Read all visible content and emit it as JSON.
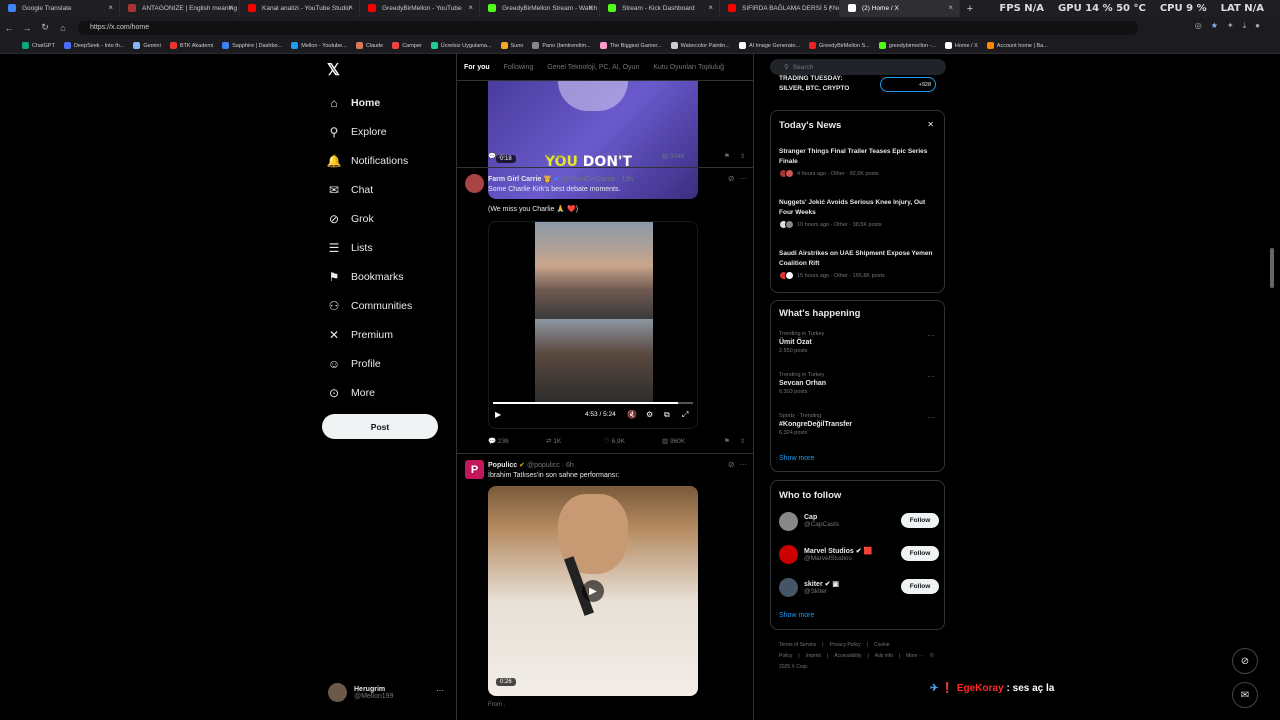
{
  "browser": {
    "tabs": [
      {
        "title": "Google Translate",
        "color": "#4285f4"
      },
      {
        "title": "ANTAGONIZE | English meaning -",
        "color": "#a33"
      },
      {
        "title": "Kanal analizi - YouTube Studio",
        "color": "#f00"
      },
      {
        "title": "GreedyBirMellon - YouTube",
        "color": "#f00"
      },
      {
        "title": "GreedyBirMellon Stream - Watch",
        "color": "#53fc18"
      },
      {
        "title": "Stream - Kick Dashboard",
        "color": "#53fc18"
      },
      {
        "title": "SIFIRDA BAĞLAMA DERSİ 5 ( Nota",
        "color": "#f00"
      },
      {
        "title": "(2) Home / X",
        "color": "#fff"
      }
    ],
    "new_tab": "+",
    "url": "https://x.com/home",
    "sysmon": [
      {
        "label": "FPS",
        "value": "N/A"
      },
      {
        "label": "GPU",
        "value": "14 %  50 °C"
      },
      {
        "label": "CPU",
        "value": "9 %"
      },
      {
        "label": "LAT",
        "value": "N/A"
      }
    ],
    "bookmarks": [
      {
        "label": "ChatGPT",
        "color": "#10a37f"
      },
      {
        "label": "DeepSeek - Into th...",
        "color": "#4d6bfe"
      },
      {
        "label": "Gemini",
        "color": "#8ab4f8"
      },
      {
        "label": "BTK Akademi",
        "color": "#e33"
      },
      {
        "label": "Sapphire | Dashbo...",
        "color": "#3b82f6"
      },
      {
        "label": "Mellon - Youtube...",
        "color": "#1d9bf0"
      },
      {
        "label": "Claude",
        "color": "#d97757"
      },
      {
        "label": "Camper",
        "color": "#e44"
      },
      {
        "label": "Ücretsiz Uygulama...",
        "color": "#2c9"
      },
      {
        "label": "Suno",
        "color": "#f5a623"
      },
      {
        "label": "Pano (bentrendim...",
        "color": "#888"
      },
      {
        "label": "The Biggest Gamer...",
        "color": "#f9c"
      },
      {
        "label": "Watercolor Paintin...",
        "color": "#ccc"
      },
      {
        "label": "AI Image Generato...",
        "color": "#fff"
      },
      {
        "label": "GreedyBirMellon S...",
        "color": "#e22"
      },
      {
        "label": "greedybirmellon -...",
        "color": "#53fc18"
      },
      {
        "label": "Home / X",
        "color": "#fff"
      },
      {
        "label": "Account home | Ba...",
        "color": "#f80"
      }
    ]
  },
  "x": {
    "logo": "𝕏",
    "nav": [
      {
        "label": "Home",
        "icon": "home-icon",
        "glyph": "⌂",
        "active": true
      },
      {
        "label": "Explore",
        "icon": "search-icon",
        "glyph": "⚲"
      },
      {
        "label": "Notifications",
        "icon": "bell-icon",
        "glyph": "🔔"
      },
      {
        "label": "Chat",
        "icon": "envelope-icon",
        "glyph": "✉"
      },
      {
        "label": "Grok",
        "icon": "grok-icon",
        "glyph": "⊘"
      },
      {
        "label": "Lists",
        "icon": "list-icon",
        "glyph": "☰"
      },
      {
        "label": "Bookmarks",
        "icon": "bookmark-icon",
        "glyph": "⚑"
      },
      {
        "label": "Communities",
        "icon": "people-icon",
        "glyph": "⚇"
      },
      {
        "label": "Premium",
        "icon": "x-icon",
        "glyph": "✕"
      },
      {
        "label": "Profile",
        "icon": "person-icon",
        "glyph": "☺"
      },
      {
        "label": "More",
        "icon": "more-circle-icon",
        "glyph": "⊙"
      }
    ],
    "post_button": "Post",
    "profile": {
      "name": "Herugrim",
      "handle": "@Mellon199",
      "more": "···"
    }
  },
  "feed": {
    "tabs": [
      "For you",
      "Following",
      "Genel Teknoloji, PC, AI, Oyun",
      "Kutu Oyunları Topluluğ"
    ],
    "tweet1": {
      "caption_yellow": "YOU",
      "caption_white": " DON'T",
      "duration": "0:18",
      "replies": "22",
      "reposts": "150",
      "likes": "1,7K",
      "views": "324K"
    },
    "tweet2": {
      "name": "Farm Girl Carrie 👸",
      "handle": "@FarmGirlCarrie · 15h",
      "text1": "Some Charlie Kirk's best debate moments.",
      "text2": "(We miss you Charlie 🙏 ❤️)",
      "time": "4:53 / 5:24",
      "replies": "236",
      "reposts": "1K",
      "likes": "6,9K",
      "views": "960K"
    },
    "tweet3": {
      "name": "Populicc",
      "handle": "@populicc · 6h",
      "text": "İbrahim Tatlıses'in son sahne performansı:",
      "duration": "0:26",
      "from": "From ."
    }
  },
  "sidebar": {
    "search_placeholder": "Search",
    "trading_line1": "TRADING TUESDAY:",
    "trading_line2": "SILVER, BTC, CRYPTO",
    "trading_count": "+928",
    "news_title": "Today's News",
    "news_close": "✕",
    "news": [
      {
        "title": "Stranger Things Final Trailer Teases Epic Series Finale",
        "meta": "4 hours ago · Other · 92,6K posts"
      },
      {
        "title": "Nuggets' Jokić Avoids Serious Knee Injury, Out Four Weeks",
        "meta": "10 hours ago · Other · 38,5K posts"
      },
      {
        "title": "Saudi Airstrikes on UAE Shipment Expose Yemen Coalition Rift",
        "meta": "15 hours ago · Other · 165,8K posts"
      }
    ],
    "happening_title": "What's happening",
    "trends": [
      {
        "context": "Trending in Turkey",
        "name": "Ümit Özat",
        "posts": "2,550 posts"
      },
      {
        "context": "Trending in Turkey",
        "name": "Sevcan Orhan",
        "posts": "6,303 posts"
      },
      {
        "context": "Sports · Trending",
        "name": "#KongreDeğilTransfer",
        "posts": "6,324 posts"
      }
    ],
    "show_more": "Show more",
    "who_title": "Who to follow",
    "who": [
      {
        "name": "Cap",
        "handle": "@CapCasts",
        "color": "#888"
      },
      {
        "name": "Marvel Studios ✔ 🟥",
        "handle": "@MarvelStudios",
        "color": "#c00"
      },
      {
        "name": "skiter ✔ ▣",
        "handle": "@Skiter",
        "color": "#456"
      }
    ],
    "follow_label": "Follow",
    "footer": [
      "Terms of Service",
      "|",
      "Privacy Policy",
      "|",
      "Cookie Policy",
      "|",
      "Imprint",
      "|",
      "Accessibility",
      "|",
      "Ads info",
      "|",
      "More ···",
      "© 2025 X Corp."
    ]
  },
  "overlay": {
    "user": "EgeKoray",
    "message": ": ses aç la"
  }
}
